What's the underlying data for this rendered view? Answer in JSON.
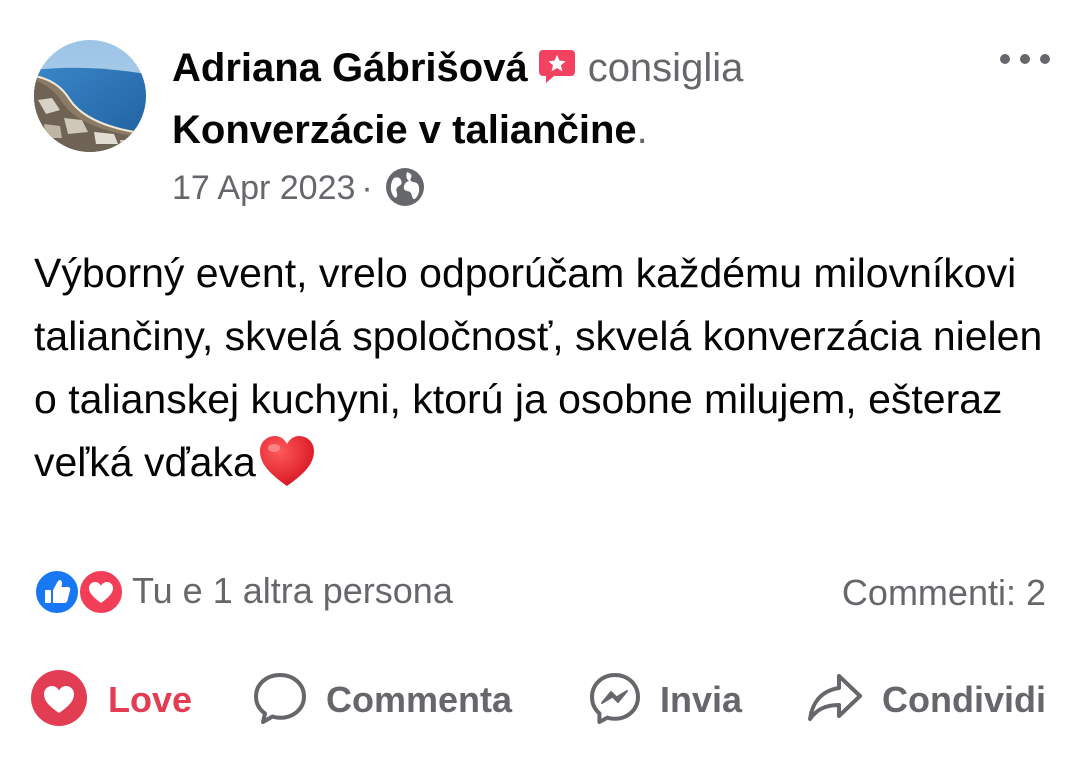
{
  "post": {
    "author": "Adriana Gábrišová",
    "recommend_verb": "consiglia",
    "page_name": "Konverzácie v taliančine",
    "trailing_dot": ".",
    "date": "17 Apr 2023",
    "separator": "·",
    "privacy_icon": "globe-icon",
    "text": "Výborný event, vrelo odporúčam každému milovníkovi taliančiny, skvelá spoločnosť, skvelá konverzácia nielen o talianskej kuchyni, ktorú ja osobne milujem, ešteraz veľká vďaka",
    "emoji": "red-heart"
  },
  "reactions": {
    "icons": [
      "like-icon",
      "love-icon"
    ],
    "summary": "Tu e 1 altra persona",
    "comments": "Commenti: 2"
  },
  "actions": {
    "love": "Love",
    "comment": "Commenta",
    "send": "Invia",
    "share": "Condividi"
  },
  "colors": {
    "love_red": "#e23d52",
    "like_blue": "#1877f2",
    "recommend_red": "#f3425f",
    "secondary_text": "#65676b",
    "primary_text": "#050505"
  }
}
